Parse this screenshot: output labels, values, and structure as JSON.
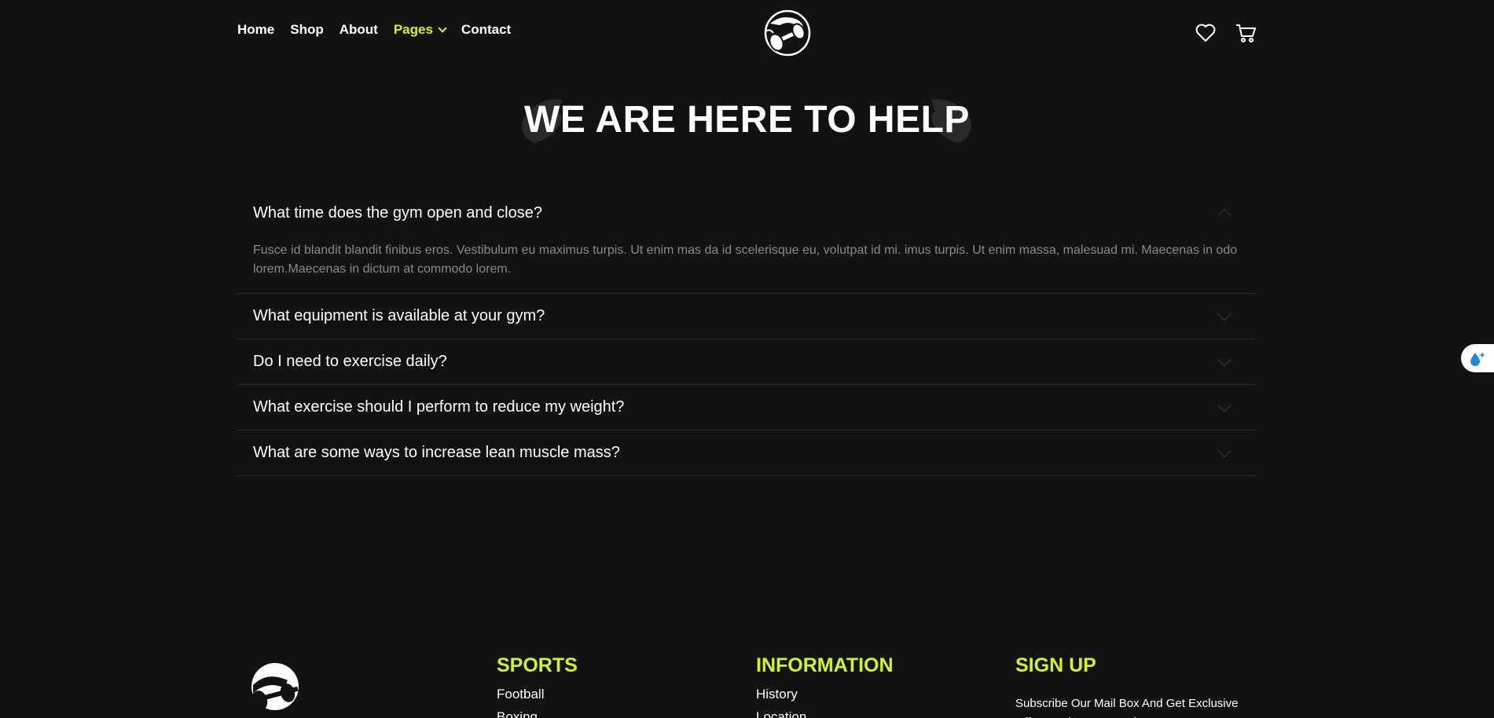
{
  "nav": {
    "items": [
      {
        "label": "Home"
      },
      {
        "label": "Shop"
      },
      {
        "label": "About"
      },
      {
        "label": "Pages"
      },
      {
        "label": "Contact"
      }
    ]
  },
  "icons": {
    "wishlist": "heart-icon",
    "cart": "cart-icon"
  },
  "page_title": "WE ARE HERE TO HELP",
  "faq": [
    {
      "q": "What time does the gym open and close?",
      "a": "Fusce id blandit blandit finibus eros. Vestibulum eu maximus turpis. Ut enim mas da id scelerisque eu, volutpat id mi. imus turpis. Ut enim massa, malesuad mi. Maecenas in odo lorem.Maecenas in dictum at commodo lorem.",
      "open": true
    },
    {
      "q": "What equipment is available at your gym?",
      "a": "",
      "open": false
    },
    {
      "q": "Do I need to exercise daily?",
      "a": "",
      "open": false
    },
    {
      "q": "What exercise should I perform to reduce my weight?",
      "a": "",
      "open": false
    },
    {
      "q": "What are some ways to increase lean muscle mass?",
      "a": "",
      "open": false
    }
  ],
  "footer": {
    "sports": {
      "heading": "SPORTS",
      "links": [
        "Football",
        "Boxing"
      ]
    },
    "information": {
      "heading": "INFORMATION",
      "links": [
        "History",
        "Location"
      ]
    },
    "signup": {
      "heading": "SIGN UP",
      "text": "Subscribe Our Mail Box And Get Exclusive Offers And Recent Updates"
    }
  },
  "colors": {
    "accent": "#d4f41f",
    "background": "#121212",
    "answer_text": "#8a8a8a"
  }
}
